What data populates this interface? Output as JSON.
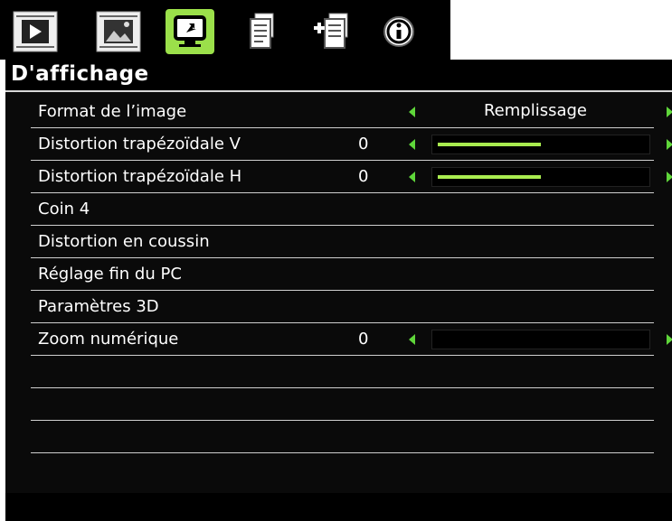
{
  "tabs": [
    {
      "icon": "play-icon",
      "active": false
    },
    {
      "icon": "picture-icon",
      "active": false
    },
    {
      "icon": "display-icon",
      "active": true
    },
    {
      "icon": "document-icon",
      "active": false
    },
    {
      "icon": "add-document-icon",
      "active": false
    },
    {
      "icon": "info-icon",
      "active": false
    }
  ],
  "menu": {
    "title": "D'affichage",
    "items": [
      {
        "label": "Format de l’image",
        "option": "Remplissage"
      },
      {
        "label": "Distortion trapézoïdale V",
        "value": "0",
        "level": 0.5
      },
      {
        "label": "Distortion trapézoïdale H",
        "value": "0",
        "level": 0.5
      },
      {
        "label": "Coin 4"
      },
      {
        "label": "Distortion en coussin"
      },
      {
        "label": "Réglage fin du PC"
      },
      {
        "label": "Paramètres 3D"
      },
      {
        "label": "Zoom numérique",
        "value": "0",
        "level": 0
      }
    ]
  },
  "colors": {
    "accent": "#5fd63a",
    "slider_fill": "#a9ec4f",
    "active_tab": "#9be04a"
  }
}
